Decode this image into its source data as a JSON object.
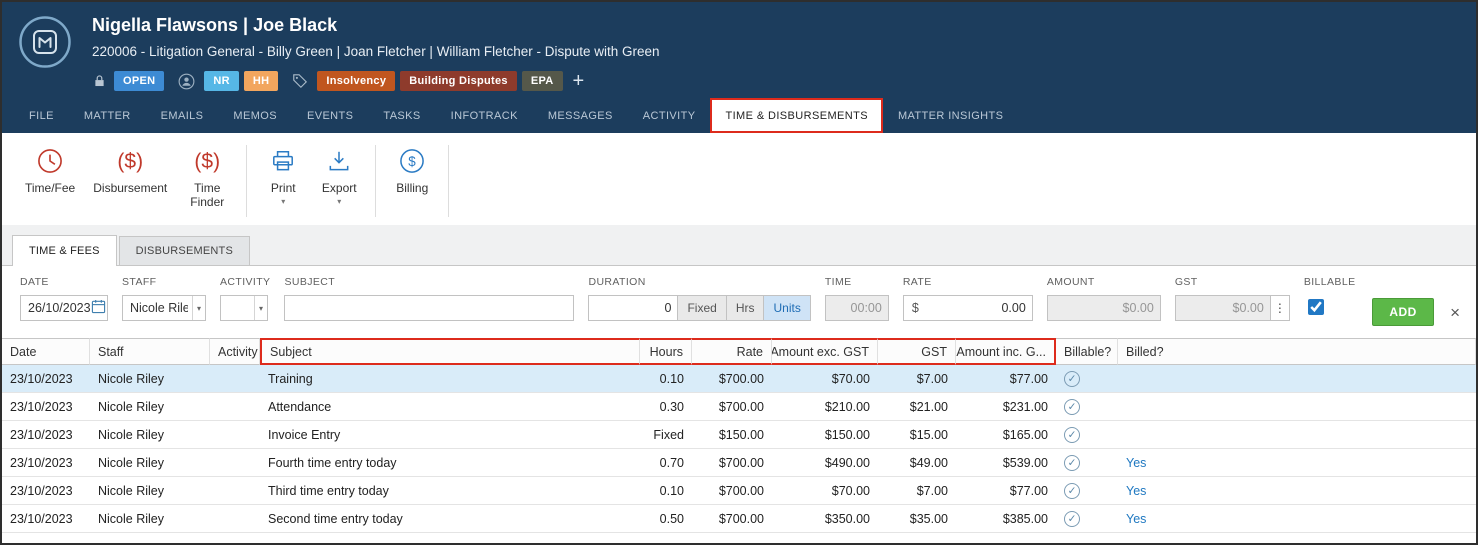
{
  "header": {
    "title": "Nigella Flawsons | Joe Black",
    "subtitle": "220006 - Litigation General - Billy Green | Joan Fletcher | William Fletcher - Dispute with Green",
    "status": "OPEN",
    "staff_initials": [
      {
        "label": "NR",
        "color": "#56b7e6"
      },
      {
        "label": "HH",
        "color": "#f2a65e"
      }
    ],
    "tags": [
      {
        "label": "Insolvency",
        "color": "#c0561f"
      },
      {
        "label": "Building Disputes",
        "color": "#8e3b2c"
      },
      {
        "label": "EPA",
        "color": "#55584a"
      }
    ],
    "add_tag_label": "+"
  },
  "nav_tabs": [
    {
      "label": "FILE"
    },
    {
      "label": "MATTER"
    },
    {
      "label": "EMAILS"
    },
    {
      "label": "MEMOS"
    },
    {
      "label": "EVENTS"
    },
    {
      "label": "TASKS"
    },
    {
      "label": "INFOTRACK"
    },
    {
      "label": "MESSAGES"
    },
    {
      "label": "ACTIVITY"
    },
    {
      "label": "TIME & DISBURSEMENTS",
      "active": true,
      "annotated": true
    },
    {
      "label": "MATTER INSIGHTS"
    }
  ],
  "toolbar": {
    "buttons": [
      {
        "label": "Time/Fee",
        "icon": "clock-icon",
        "color": "#c0392b"
      },
      {
        "label": "Disbursement",
        "icon": "dollar-paren-icon",
        "color": "#c0392b"
      },
      {
        "label": "Time Finder",
        "icon": "dollar-paren-icon",
        "color": "#c0392b",
        "two_line": true,
        "divider_after": true
      },
      {
        "label": "Print",
        "icon": "printer-icon",
        "color": "#2b7bc4",
        "dropdown": true
      },
      {
        "label": "Export",
        "icon": "export-icon",
        "color": "#2b7bc4",
        "dropdown": true,
        "divider_after": true
      },
      {
        "label": "Billing",
        "icon": "dollar-circle-icon",
        "color": "#2b7bc4",
        "divider_after": true
      }
    ]
  },
  "subtabs": [
    {
      "label": "TIME & FEES",
      "active": true
    },
    {
      "label": "DISBURSEMENTS"
    }
  ],
  "entry_form": {
    "date": {
      "label": "DATE",
      "value": "26/10/2023"
    },
    "staff": {
      "label": "STAFF",
      "value": "Nicole Riley"
    },
    "activity": {
      "label": "ACTIVITY",
      "value": ""
    },
    "subject": {
      "label": "SUBJECT",
      "value": ""
    },
    "duration": {
      "label": "DURATION",
      "value": "0",
      "modes": [
        "Fixed",
        "Hrs",
        "Units"
      ],
      "selected_mode": "Units"
    },
    "time": {
      "label": "TIME",
      "value": "00:00"
    },
    "rate": {
      "label": "RATE",
      "prefix": "$",
      "value": "0.00"
    },
    "amount": {
      "label": "AMOUNT",
      "value": "$0.00"
    },
    "gst": {
      "label": "GST",
      "value": "$0.00",
      "menu": "⋮"
    },
    "billable": {
      "label": "BILLABLE",
      "checked": true
    },
    "add_label": "ADD",
    "close_label": "×"
  },
  "table": {
    "columns": [
      {
        "label": "Date",
        "align": "left"
      },
      {
        "label": "Staff",
        "align": "left"
      },
      {
        "label": "Activity",
        "align": "left"
      },
      {
        "label": "Subject",
        "align": "left",
        "highlighted": true
      },
      {
        "label": "Hours",
        "align": "right",
        "highlighted": true
      },
      {
        "label": "Rate",
        "align": "right",
        "highlighted": true
      },
      {
        "label": "Amount exc. GST",
        "align": "right",
        "highlighted": true
      },
      {
        "label": "GST",
        "align": "right",
        "highlighted": true
      },
      {
        "label": "Amount inc. G...",
        "align": "right",
        "highlighted": true
      },
      {
        "label": "Billable?",
        "align": "left"
      },
      {
        "label": "Billed?",
        "align": "left"
      }
    ],
    "rows": [
      {
        "date": "23/10/2023",
        "staff": "Nicole Riley",
        "activity": "",
        "subject": "Training",
        "hours": "0.10",
        "rate": "$700.00",
        "amount_exc_gst": "$70.00",
        "gst": "$7.00",
        "amount_inc_gst": "$77.00",
        "billable": true,
        "billed": "",
        "selected": true
      },
      {
        "date": "23/10/2023",
        "staff": "Nicole Riley",
        "activity": "",
        "subject": "Attendance",
        "hours": "0.30",
        "rate": "$700.00",
        "amount_exc_gst": "$210.00",
        "gst": "$21.00",
        "amount_inc_gst": "$231.00",
        "billable": true,
        "billed": ""
      },
      {
        "date": "23/10/2023",
        "staff": "Nicole Riley",
        "activity": "",
        "subject": "Invoice Entry",
        "hours": "Fixed",
        "rate": "$150.00",
        "amount_exc_gst": "$150.00",
        "gst": "$15.00",
        "amount_inc_gst": "$165.00",
        "billable": true,
        "billed": ""
      },
      {
        "date": "23/10/2023",
        "staff": "Nicole Riley",
        "activity": "",
        "subject": "Fourth time entry today",
        "hours": "0.70",
        "rate": "$700.00",
        "amount_exc_gst": "$490.00",
        "gst": "$49.00",
        "amount_inc_gst": "$539.00",
        "billable": true,
        "billed": "Yes"
      },
      {
        "date": "23/10/2023",
        "staff": "Nicole Riley",
        "activity": "",
        "subject": "Third time entry today",
        "hours": "0.10",
        "rate": "$700.00",
        "amount_exc_gst": "$70.00",
        "gst": "$7.00",
        "amount_inc_gst": "$77.00",
        "billable": true,
        "billed": "Yes"
      },
      {
        "date": "23/10/2023",
        "staff": "Nicole Riley",
        "activity": "",
        "subject": "Second time entry today",
        "hours": "0.50",
        "rate": "$700.00",
        "amount_exc_gst": "$350.00",
        "gst": "$35.00",
        "amount_inc_gst": "$385.00",
        "billable": true,
        "billed": "Yes"
      }
    ]
  },
  "colors": {
    "header_bg": "#1c3d5d",
    "annotation_red": "#dd2b1c",
    "selected_row": "#d9ecf9",
    "add_button_green": "#5cb848",
    "link_blue": "#1f78c1",
    "open_badge_blue": "#3d8bd4"
  }
}
